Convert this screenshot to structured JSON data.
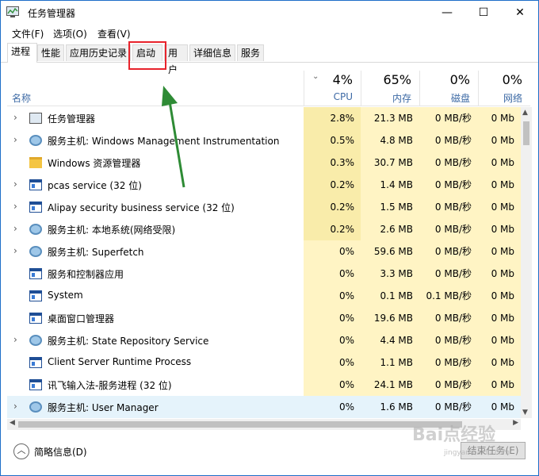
{
  "window": {
    "title": "任务管理器",
    "minimize_glyph": "—",
    "maximize_glyph": "☐",
    "close_glyph": "✕"
  },
  "menu": [
    "文件(F)",
    "选项(O)",
    "查看(V)"
  ],
  "tabs": [
    "进程",
    "性能",
    "应用历史记录",
    "启动",
    "用户",
    "详细信息",
    "服务"
  ],
  "header": {
    "name_label": "名称",
    "sort_glyph": "⌄",
    "cpu": {
      "pct": "4%",
      "label": "CPU"
    },
    "memory": {
      "pct": "65%",
      "label": "内存"
    },
    "disk": {
      "pct": "0%",
      "label": "磁盘"
    },
    "network": {
      "pct": "0%",
      "label": "网络"
    }
  },
  "rows": [
    {
      "name": "任务管理器",
      "icon": "taskmgr-icon",
      "expand": true,
      "cpu": "2.8%",
      "mem": "21.3 MB",
      "disk": "0 MB/秒",
      "net": "0 Mb"
    },
    {
      "name": "服务主机: Windows Management Instrumentation",
      "icon": "gear-icon",
      "expand": true,
      "cpu": "0.5%",
      "mem": "4.8 MB",
      "disk": "0 MB/秒",
      "net": "0 Mb"
    },
    {
      "name": "Windows 资源管理器",
      "icon": "folder-icon",
      "expand": false,
      "cpu": "0.3%",
      "mem": "30.7 MB",
      "disk": "0 MB/秒",
      "net": "0 Mb"
    },
    {
      "name": "pcas service (32 位)",
      "icon": "window-icon",
      "expand": true,
      "cpu": "0.2%",
      "mem": "1.4 MB",
      "disk": "0 MB/秒",
      "net": "0 Mb"
    },
    {
      "name": "Alipay security business service (32 位)",
      "icon": "window-icon",
      "expand": true,
      "cpu": "0.2%",
      "mem": "1.5 MB",
      "disk": "0 MB/秒",
      "net": "0 Mb"
    },
    {
      "name": "服务主机: 本地系统(网络受限)",
      "icon": "gear-icon",
      "expand": true,
      "cpu": "0.2%",
      "mem": "2.6 MB",
      "disk": "0 MB/秒",
      "net": "0 Mb"
    },
    {
      "name": "服务主机: Superfetch",
      "icon": "gear-icon",
      "expand": true,
      "cpu": "0%",
      "mem": "59.6 MB",
      "disk": "0 MB/秒",
      "net": "0 Mb"
    },
    {
      "name": "服务和控制器应用",
      "icon": "window-icon",
      "expand": false,
      "cpu": "0%",
      "mem": "3.3 MB",
      "disk": "0 MB/秒",
      "net": "0 Mb"
    },
    {
      "name": "System",
      "icon": "window-icon",
      "expand": false,
      "cpu": "0%",
      "mem": "0.1 MB",
      "disk": "0.1 MB/秒",
      "net": "0 Mb"
    },
    {
      "name": "桌面窗口管理器",
      "icon": "window-icon",
      "expand": false,
      "cpu": "0%",
      "mem": "19.6 MB",
      "disk": "0 MB/秒",
      "net": "0 Mb"
    },
    {
      "name": "服务主机: State Repository Service",
      "icon": "gear-icon",
      "expand": true,
      "cpu": "0%",
      "mem": "4.4 MB",
      "disk": "0 MB/秒",
      "net": "0 Mb"
    },
    {
      "name": "Client Server Runtime Process",
      "icon": "window-icon",
      "expand": false,
      "cpu": "0%",
      "mem": "1.1 MB",
      "disk": "0 MB/秒",
      "net": "0 Mb"
    },
    {
      "name": "讯飞输入法-服务进程 (32 位)",
      "icon": "window-icon",
      "expand": false,
      "cpu": "0%",
      "mem": "24.1 MB",
      "disk": "0 MB/秒",
      "net": "0 Mb"
    },
    {
      "name": "服务主机: User Manager",
      "icon": "gear-icon",
      "expand": true,
      "cpu": "0%",
      "mem": "1.6 MB",
      "disk": "0 MB/秒",
      "net": "0 Mb",
      "selected": true
    }
  ],
  "footer": {
    "fewer_details": "简略信息(D)",
    "fewer_glyph": "︿",
    "end_task": "结束任务(E)"
  },
  "scroll": {
    "up": "▲",
    "down": "▼",
    "left": "◀",
    "right": "▶"
  },
  "watermark": {
    "text": "Bai点经验",
    "url": "jingyan.baidu.com"
  },
  "colors": {
    "cell_light": "#fff4c4",
    "cell_mid": "#f9ecaa",
    "selected_row": "#e5f3fb",
    "highlight_box": "#e8232c",
    "arrow": "#2e8b35"
  }
}
